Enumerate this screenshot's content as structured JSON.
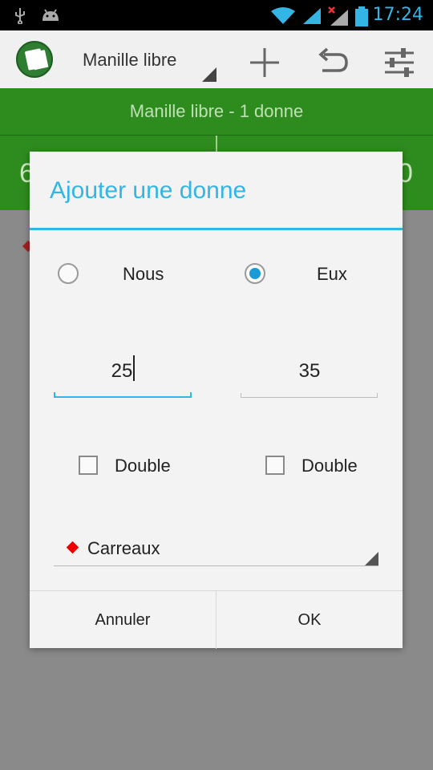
{
  "status_bar": {
    "time": "17:24",
    "icons": [
      "usb-icon",
      "android-icon",
      "wifi-icon",
      "signal-icon",
      "signal-no-data-icon",
      "battery-icon"
    ]
  },
  "action_bar": {
    "game_name": "Manille libre",
    "icons": [
      "app-cards-icon",
      "add-icon",
      "undo-icon",
      "settings-sliders-icon"
    ]
  },
  "banner": {
    "title": "Manille libre - 1 donne"
  },
  "scores": {
    "left_partial": "6",
    "right_partial": "0"
  },
  "dialog": {
    "title": "Ajouter une donne",
    "team_left": "Nous",
    "team_right": "Eux",
    "selected_team": "Eux",
    "score_left": "25",
    "score_right": "35",
    "double_left": "Double",
    "double_right": "Double",
    "suit": "Carreaux",
    "cancel": "Annuler",
    "ok": "OK"
  },
  "colors": {
    "accent": "#33b5e5",
    "banner_green": "#2e8b1e",
    "radio_selected": "#1a9ad6",
    "diamond_red": "#e00000"
  }
}
